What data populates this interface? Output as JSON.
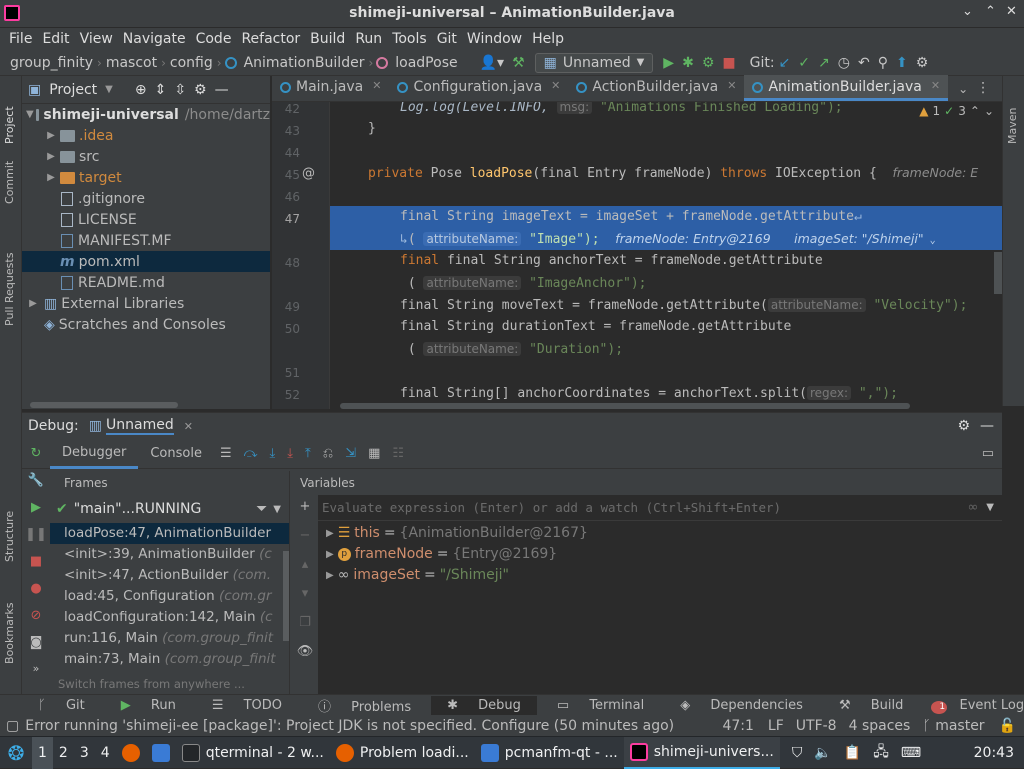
{
  "window": {
    "title": "shimeji-universal – AnimationBuilder.java"
  },
  "menu": [
    "File",
    "Edit",
    "View",
    "Navigate",
    "Code",
    "Refactor",
    "Build",
    "Run",
    "Tools",
    "Git",
    "Window",
    "Help"
  ],
  "breadcrumbs": [
    "group_finity",
    "mascot",
    "config",
    "AnimationBuilder",
    "loadPose"
  ],
  "run_config": "Unnamed",
  "git_label": "Git:",
  "left_strip": {
    "project": "Project",
    "commit": "Commit",
    "pull_requests": "Pull Requests",
    "structure": "Structure",
    "bookmarks": "Bookmarks"
  },
  "right_strip": {
    "maven": "Maven"
  },
  "project": {
    "title": "Project",
    "root": {
      "name": "shimeji-universal",
      "path": "/home/dartz"
    },
    "items": [
      ".idea",
      "src",
      "target",
      ".gitignore",
      "LICENSE",
      "MANIFEST.MF",
      "pom.xml",
      "README.md"
    ],
    "external": "External Libraries",
    "scratches": "Scratches and Consoles"
  },
  "tabs": [
    "Main.java",
    "Configuration.java",
    "ActionBuilder.java",
    "AnimationBuilder.java"
  ],
  "inspections": {
    "warnings": "1",
    "ok": "3"
  },
  "gutter": [
    "42",
    "43",
    "44",
    "45",
    "46",
    "47",
    "48",
    "49",
    "50",
    "51",
    "52"
  ],
  "code": {
    "l42": "Log.log(Level.INFO,",
    "l42_hint": "msg:",
    "l42_str": "\"Animations Finished Loading\");",
    "l45_mod": "private",
    "l45_type": "Pose",
    "l45_name": "loadPose",
    "l45_rest": "(final Entry frameNode)",
    "l45_throws": "throws",
    "l45_exc": "IOException {",
    "l45_hint": "frameNode: E",
    "l47a": "final String imageText = imageSet + frameNode.getAttribute",
    "l47b_hint": "attributeName:",
    "l47b_str": "\"Image\");",
    "l47b_dbg1": "frameNode: Entry@2169",
    "l47b_dbg2": "imageSet: \"/Shimeji\"",
    "l48": "final String anchorText = frameNode.getAttribute",
    "l48b_hint": "attributeName:",
    "l48b_str": "\"ImageAnchor\");",
    "l49": "final String moveText = frameNode.getAttribute(",
    "l49_hint": "attributeName:",
    "l49_str": "\"Velocity\");",
    "l50": "final String durationText = frameNode.getAttribute",
    "l50b_hint": "attributeName:",
    "l50b_str": "\"Duration\");",
    "l52": "final String[] anchorCoordinates = anchorText.split(",
    "l52_hint": "regex:",
    "l52_str": "\",\");"
  },
  "debug": {
    "label": "Debug:",
    "session": "Unnamed",
    "tab_debugger": "Debugger",
    "tab_console": "Console",
    "frames_title": "Frames",
    "thread": "\"main\"...RUNNING",
    "frames": [
      {
        "method": "loadPose:47, AnimationBuilder",
        "cls": ""
      },
      {
        "method": "<init>:39, AnimationBuilder",
        "cls": "(c"
      },
      {
        "method": "<init>:47, ActionBuilder",
        "cls": "(com."
      },
      {
        "method": "load:45, Configuration",
        "cls": "(com.gr"
      },
      {
        "method": "loadConfiguration:142, Main",
        "cls": "(c"
      },
      {
        "method": "run:116, Main",
        "cls": "(com.group_finit"
      },
      {
        "method": "main:73, Main",
        "cls": "(com.group_finit"
      }
    ],
    "switch_hint": "Switch frames from anywhere ...",
    "variables_title": "Variables",
    "eval_placeholder": "Evaluate expression (Enter) or add a watch (Ctrl+Shift+Enter)",
    "vars": [
      {
        "name": "this",
        "value": "{AnimationBuilder@2167}"
      },
      {
        "name": "frameNode",
        "value": "{Entry@2169}"
      },
      {
        "name": "imageSet",
        "value": "\"/Shimeji\""
      }
    ]
  },
  "bottom_tools": [
    "Git",
    "Run",
    "TODO",
    "Problems",
    "Debug",
    "Terminal",
    "Dependencies",
    "Build"
  ],
  "event_log": {
    "count": "1",
    "label": "Event Log"
  },
  "status": {
    "message": "Error running 'shimeji-ee [package]': Project JDK is not specified. Configure (50 minutes ago)",
    "position": "47:1",
    "line_sep": "LF",
    "encoding": "UTF-8",
    "indent": "4 spaces",
    "branch": "master"
  },
  "taskbar": {
    "desktops": [
      "1",
      "2",
      "3",
      "4"
    ],
    "tasks": [
      "qterminal - 2 w...",
      "Problem loadi...",
      "pcmanfm-qt - ...",
      "shimeji-univers..."
    ],
    "clock": "20:43"
  },
  "colors": {
    "accent": "#4a88c7",
    "selection": "#2d5fa6",
    "bg": "#2b2b2b",
    "panel": "#3c3f41"
  }
}
